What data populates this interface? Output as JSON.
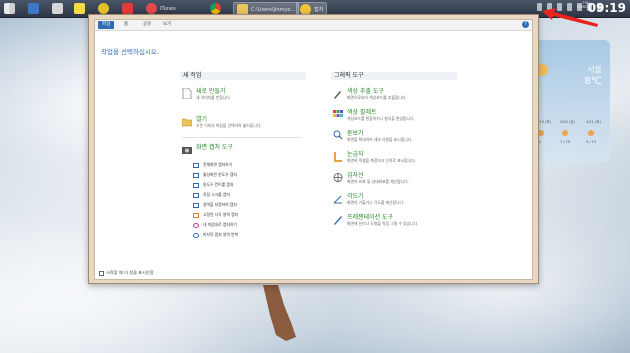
{
  "taskbar": {
    "items": [
      {
        "label": "",
        "icon": "windows-start-icon",
        "color": "#d0d0d0"
      },
      {
        "label": "",
        "icon": "computer-icon",
        "color": "#3c78c8"
      },
      {
        "label": "",
        "icon": "sticky-notes-icon",
        "color": "#f6d84a"
      },
      {
        "label": "",
        "icon": "kakaotalk-icon",
        "color": "#f6e04a"
      },
      {
        "label": "",
        "icon": "flipboard-icon",
        "color": "#e03a3a"
      },
      {
        "label": "iTunes",
        "icon": "itunes-icon",
        "color": "#e24a4a"
      },
      {
        "label": "",
        "icon": "chrome-icon",
        "color": "#e8b83a"
      },
      {
        "label": "C:\\Users\\jinmyo...",
        "icon": "folder-icon",
        "color": "#e9c55a"
      },
      {
        "label": "캡처",
        "icon": "capture-tool-icon",
        "color": "#f0c040"
      }
    ],
    "clock": {
      "time": "09:19",
      "day": "THU",
      "date": "MARCH"
    }
  },
  "window": {
    "tabs": [
      "파일",
      "홈",
      "공유",
      "보기"
    ],
    "heading": "작업을 선택하십시오.",
    "left": {
      "title": "새 작업",
      "items": [
        {
          "title": "새로 만들기",
          "desc": "새 이미지를 만듭니다.",
          "icon": "new-document-icon"
        },
        {
          "title": "열기",
          "desc": "기존 이미지 파일을 선택하여 불러옵니다.",
          "icon": "open-folder-icon"
        }
      ],
      "capture": {
        "title": "화면 캡처 도구",
        "icon": "camera-icon",
        "items": [
          "전체화면 캡처하기",
          "활성화된 윈도우 캡처",
          "윈도우 컨트롤 캡처",
          "직접 스크롤 캡처",
          "영역을 지정하여 캡처",
          "고정된 사각 영역 캡처",
          "내 마음대로 캡처하기",
          "마지막 캡처 영역 반복"
        ]
      }
    },
    "right": {
      "title": "그래픽 도구",
      "items": [
        {
          "title": "색상 추출 도구",
          "desc": "화면으로부터 색상코드를 추출합니다.",
          "icon": "eyedropper-icon"
        },
        {
          "title": "색상 팔레트",
          "desc": "색상코드를 편집하거나 형식을 변경합니다.",
          "icon": "palette-icon"
        },
        {
          "title": "돋보기",
          "desc": "화면을 확대하여 세부 사항을 표시합니다.",
          "icon": "magnifier-icon"
        },
        {
          "title": "눈금자",
          "desc": "화면의 픽셀을 측정하고 인치로 표시합니다.",
          "icon": "ruler-icon"
        },
        {
          "title": "십자선",
          "desc": "화면의 좌표 및 상대좌표를 계산합니다.",
          "icon": "crosshair-icon"
        },
        {
          "title": "각도기",
          "desc": "화면의 기울기나 각도를 계산합니다.",
          "icon": "protractor-icon"
        },
        {
          "title": "프레젠테이션 도구",
          "desc": "화면에 선이나 도형을 직접 그릴 수 있습니다.",
          "icon": "pen-icon"
        }
      ]
    },
    "bottom_check": "시작할 때 이 창을 표시안함"
  },
  "weather": {
    "city": "서울",
    "temp": "8℃",
    "days": [
      "3/19 (목)",
      "3/20 (금)",
      "3/21 (토)"
    ],
    "lows": [
      "16",
      "7 / 19",
      "9 / 15"
    ]
  },
  "colors": {
    "accent": "#2e6db4",
    "green": "#2a8a2a",
    "arrow": "#e8231c"
  }
}
